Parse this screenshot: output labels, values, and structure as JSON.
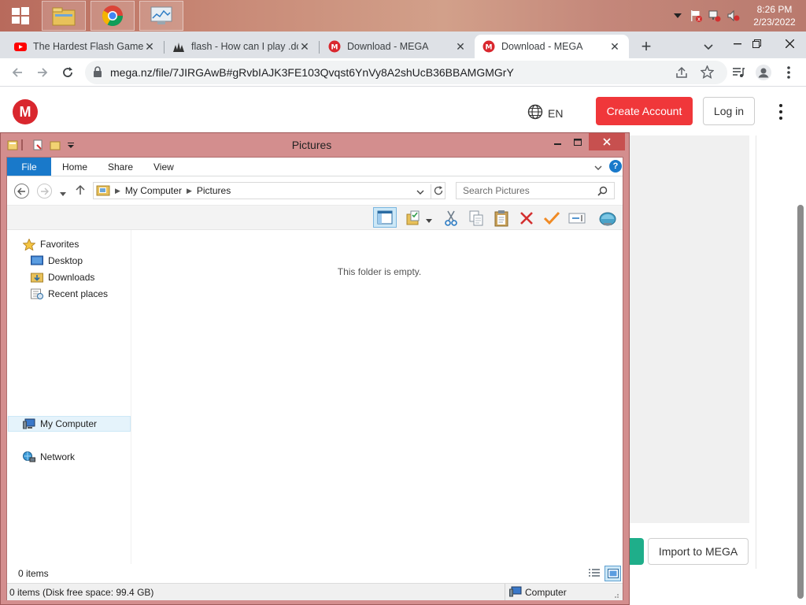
{
  "taskbar": {
    "start_icon": "windows-logo-icon",
    "pinned": [
      {
        "name": "file-explorer-icon"
      },
      {
        "name": "chrome-icon"
      },
      {
        "name": "resource-monitor-icon"
      }
    ],
    "tray_icons": [
      "chevron-up-icon",
      "flag-alert-icon",
      "network-icon",
      "volume-muted-icon"
    ],
    "clock_time": "8:26 PM",
    "clock_date": "2/23/2022"
  },
  "browser": {
    "tabs": [
      {
        "title": "The Hardest Flash Game",
        "favicon": "youtube-icon",
        "active": false
      },
      {
        "title": "flash - How can I play .dc",
        "favicon": "sourceforge-icon",
        "active": false
      },
      {
        "title": "Download - MEGA",
        "favicon": "mega-icon",
        "active": false
      },
      {
        "title": "Download - MEGA",
        "favicon": "mega-icon",
        "active": true
      }
    ],
    "new_tab_label": "+",
    "url": "mega.nz/file/7JIRGAwB#gRvbIAJK3FE103Qvqst6YnVy8A2shUcB36BBAMGMGrY"
  },
  "mega": {
    "logo_letter": "M",
    "lang": "EN",
    "create_account": "Create Account",
    "login": "Log in",
    "import_label": "Import to MEGA",
    "brand_color": "#d9272e",
    "accent_red": "#f0373a",
    "green": "#1fae8a"
  },
  "explorer": {
    "title": "Pictures",
    "ribbon_tabs": [
      "File",
      "Home",
      "Share",
      "View"
    ],
    "address": {
      "root": "My Computer",
      "current": "Pictures"
    },
    "search_placeholder": "Search Pictures",
    "nav": {
      "favorites": "Favorites",
      "desktop": "Desktop",
      "downloads": "Downloads",
      "recent": "Recent places",
      "my_computer": "My Computer",
      "network": "Network"
    },
    "empty_message": "This folder is empty.",
    "items_count": "0 items",
    "status_text": "0 items (Disk free space: 99.4 GB)",
    "status_location": "Computer",
    "frame_color": "#d38e8e"
  }
}
